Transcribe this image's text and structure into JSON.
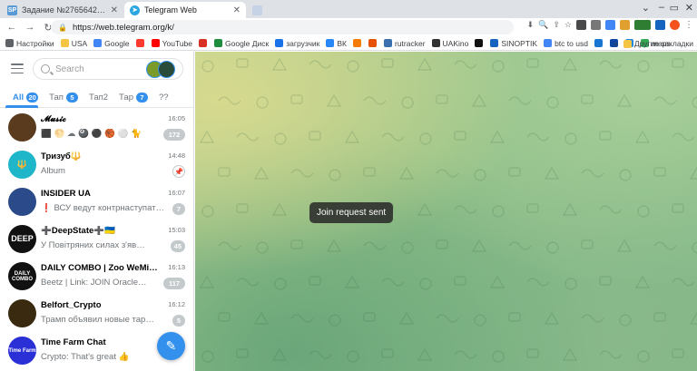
{
  "browser": {
    "tabs": [
      {
        "title": "Задание №2765642 - просмотр з",
        "favicon": "SP",
        "active": false
      },
      {
        "title": "Telegram Web",
        "favicon": "telegram",
        "active": true
      },
      {
        "title": "",
        "favicon": "blank",
        "active": false
      }
    ],
    "url": "https://web.telegram.org/k/"
  },
  "bookmarks": {
    "items": [
      {
        "label": "Настройки",
        "icon": "gear-icon"
      },
      {
        "label": "USA",
        "icon": "folder-icon"
      },
      {
        "label": "Google",
        "icon": "google-icon"
      },
      {
        "label": "",
        "icon": "yandex-icon"
      },
      {
        "label": "YouTube",
        "icon": "youtube-icon"
      },
      {
        "label": "",
        "icon": "gmail-icon"
      },
      {
        "label": "Google Диск",
        "icon": "drive-icon"
      },
      {
        "label": "загрузчик",
        "icon": "download-icon"
      },
      {
        "label": "ВК",
        "icon": "vk-icon"
      },
      {
        "label": "",
        "icon": "bookmark-icon"
      },
      {
        "label": "",
        "icon": "bookmark-icon"
      },
      {
        "label": "rutracker",
        "icon": "rutracker-icon"
      },
      {
        "label": "UAKino",
        "icon": "uakino-icon"
      },
      {
        "label": "",
        "icon": "thermometer-icon"
      },
      {
        "label": "SINOPTIK",
        "icon": "sinoptik-icon"
      },
      {
        "label": "btc to usd",
        "icon": "google-icon"
      },
      {
        "label": "",
        "icon": "bookmark-icon"
      },
      {
        "label": "",
        "icon": "bookmark-icon"
      },
      {
        "label": "",
        "icon": "bookmark-icon"
      },
      {
        "label": "maps",
        "icon": "maps-icon"
      }
    ],
    "other": "Другие закладки"
  },
  "telegram": {
    "search_placeholder": "Search",
    "folders": [
      {
        "label": "All",
        "badge": "20",
        "active": true
      },
      {
        "label": "Тап",
        "badge": "5",
        "active": false
      },
      {
        "label": "Тап2",
        "badge": "",
        "active": false
      },
      {
        "label": "Тар",
        "badge": "7",
        "active": false
      },
      {
        "label": "??",
        "badge": "",
        "active": false
      }
    ],
    "chats": [
      {
        "name": "𝓜𝓾𝓼𝓲𝓬",
        "time": "16:05",
        "preview": "⬛ 🌕 ☁ 🎱 ⚫ 🏀 ⚪ 🐈",
        "badge": "172",
        "avatar_color": "#5a3b1e",
        "avatar_text": ""
      },
      {
        "name": "Тризуб🔱",
        "time": "14:48",
        "preview": "Album",
        "badge": "",
        "pinned": true,
        "avatar_color": "#1fb6c9",
        "avatar_text": "🔱"
      },
      {
        "name": "INSIDER UA",
        "time": "16:07",
        "preview": "❗ ВСУ ведут контрнаступат…",
        "badge": "7",
        "avatar_color": "#2a4a8a",
        "avatar_text": ""
      },
      {
        "name": "➕DeepState➕🇺🇦",
        "time": "15:03",
        "preview": "У Повітряних силах з'яв…",
        "badge": "45",
        "avatar_color": "#111111",
        "avatar_text": "DEEP"
      },
      {
        "name": "DAILY COMBO | Zoo WeMine …",
        "time": "16:13",
        "preview": "Beetz | Link: JOIN Oracle…",
        "badge": "117",
        "avatar_color": "#111111",
        "avatar_text": "DAILY COMBO"
      },
      {
        "name": "Belfort_Crypto",
        "time": "16:12",
        "preview": "Трамп объявил новые тар…",
        "badge": "5",
        "avatar_color": "#3a2a10",
        "avatar_text": ""
      },
      {
        "name": "Time Farm Chat",
        "time": "",
        "preview": "Crypto: That's great 👍",
        "badge": "",
        "avatar_color": "#2b2fd6",
        "avatar_text": "Time Farm"
      }
    ],
    "toast": "Join request sent"
  }
}
